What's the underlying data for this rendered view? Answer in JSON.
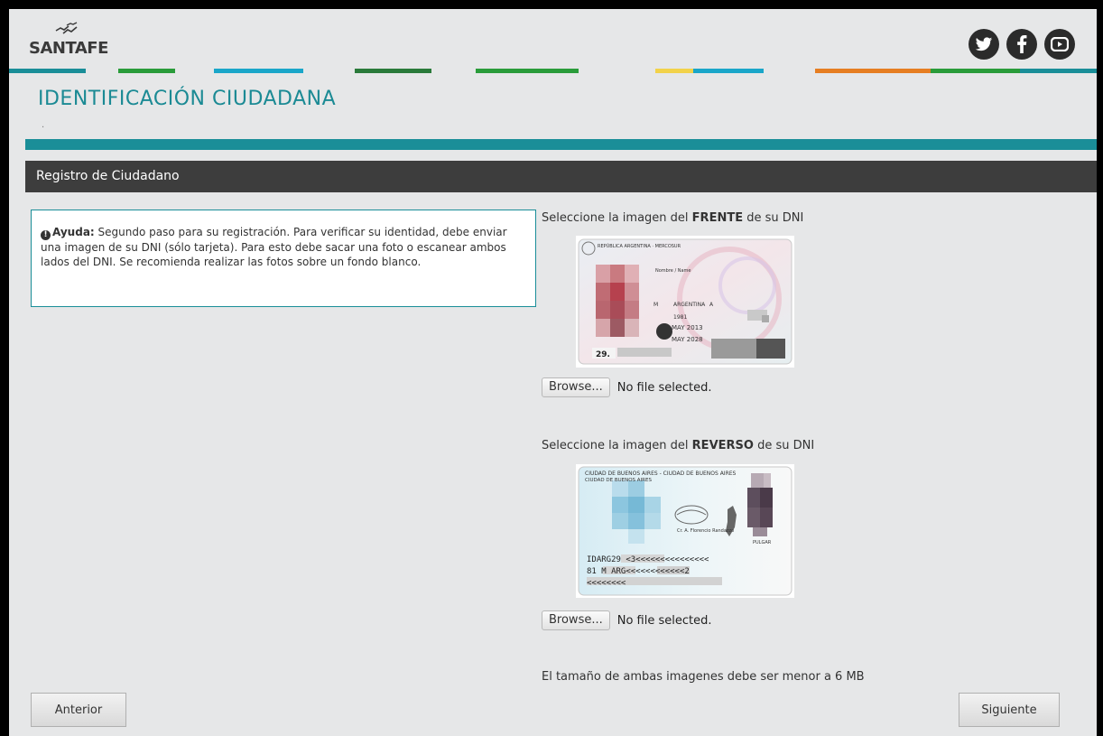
{
  "header": {
    "logo_text": "SANTAFE",
    "social": [
      {
        "name": "twitter-icon",
        "glyph": "t"
      },
      {
        "name": "facebook-icon",
        "glyph": "f"
      },
      {
        "name": "youtube-icon",
        "glyph": "▶"
      }
    ],
    "stripe_colors": [
      "#1a8e98",
      "#e6e7e8",
      "#2a9c3a",
      "#e6e7e8",
      "#1aa6c9",
      "#e6e7e8",
      "#2a7a3a",
      "#e6e7e8",
      "#2a9c3a",
      "#e6e7e8",
      "#f2d24a",
      "#1aa6c9",
      "#e6e7e8",
      "#e67e22",
      "#2a9c3a",
      "#1a8e98"
    ]
  },
  "page": {
    "title": "IDENTIFICACIÓN CIUDADANA",
    "subtitle_dot": "."
  },
  "section": {
    "title": "Registro de Ciudadano"
  },
  "help": {
    "label": "Ayuda:",
    "text": " Segundo paso para su registración. Para verificar su identidad, debe enviar una imagen de su DNI (sólo tarjeta). Para esto debe sacar una foto o escanear ambos lados del DNI. Se recomienda realizar las fotos sobre un fondo blanco."
  },
  "front": {
    "label_pre": "Seleccione la imagen del ",
    "label_bold": "FRENTE",
    "label_post": " de su DNI",
    "browse_label": "Browse...",
    "file_status": "No file selected.",
    "card_header": "REPÚBLICA ARGENTINA · MERCOSUR",
    "card_name": "Nombre / Name",
    "card_nationality": "ARGENTINA",
    "card_sex": "M",
    "card_ejemplar": "A",
    "card_birth": "1981",
    "card_issue": "MAY 2013",
    "card_expiry": "MAY 2028",
    "card_doc": "29."
  },
  "back": {
    "label_pre": "Seleccione la imagen del ",
    "label_bold": "REVERSO",
    "label_post": " de su DNI",
    "browse_label": "Browse...",
    "file_status": "No file selected.",
    "card_domicilio": "CIUDAD DE BUENOS AIRES - CIUDAD DE BUENOS AIRES",
    "card_lugar": "CIUDAD DE BUENOS AIRES",
    "card_signer": "Cr. A. Florencio Randazzo",
    "card_pulgar": "PULGAR",
    "mrz1": "IDARG29            <3<<<<<<<<<<<<<<<",
    "mrz2": "81        M         ARG<<<<<<<<<<<<2",
    "mrz3": "                        <<<<<<<<"
  },
  "size_note": "El tamaño de ambas imagenes debe ser menor a 6 MB",
  "nav": {
    "prev_label": "Anterior",
    "next_label": "Siguiente"
  }
}
